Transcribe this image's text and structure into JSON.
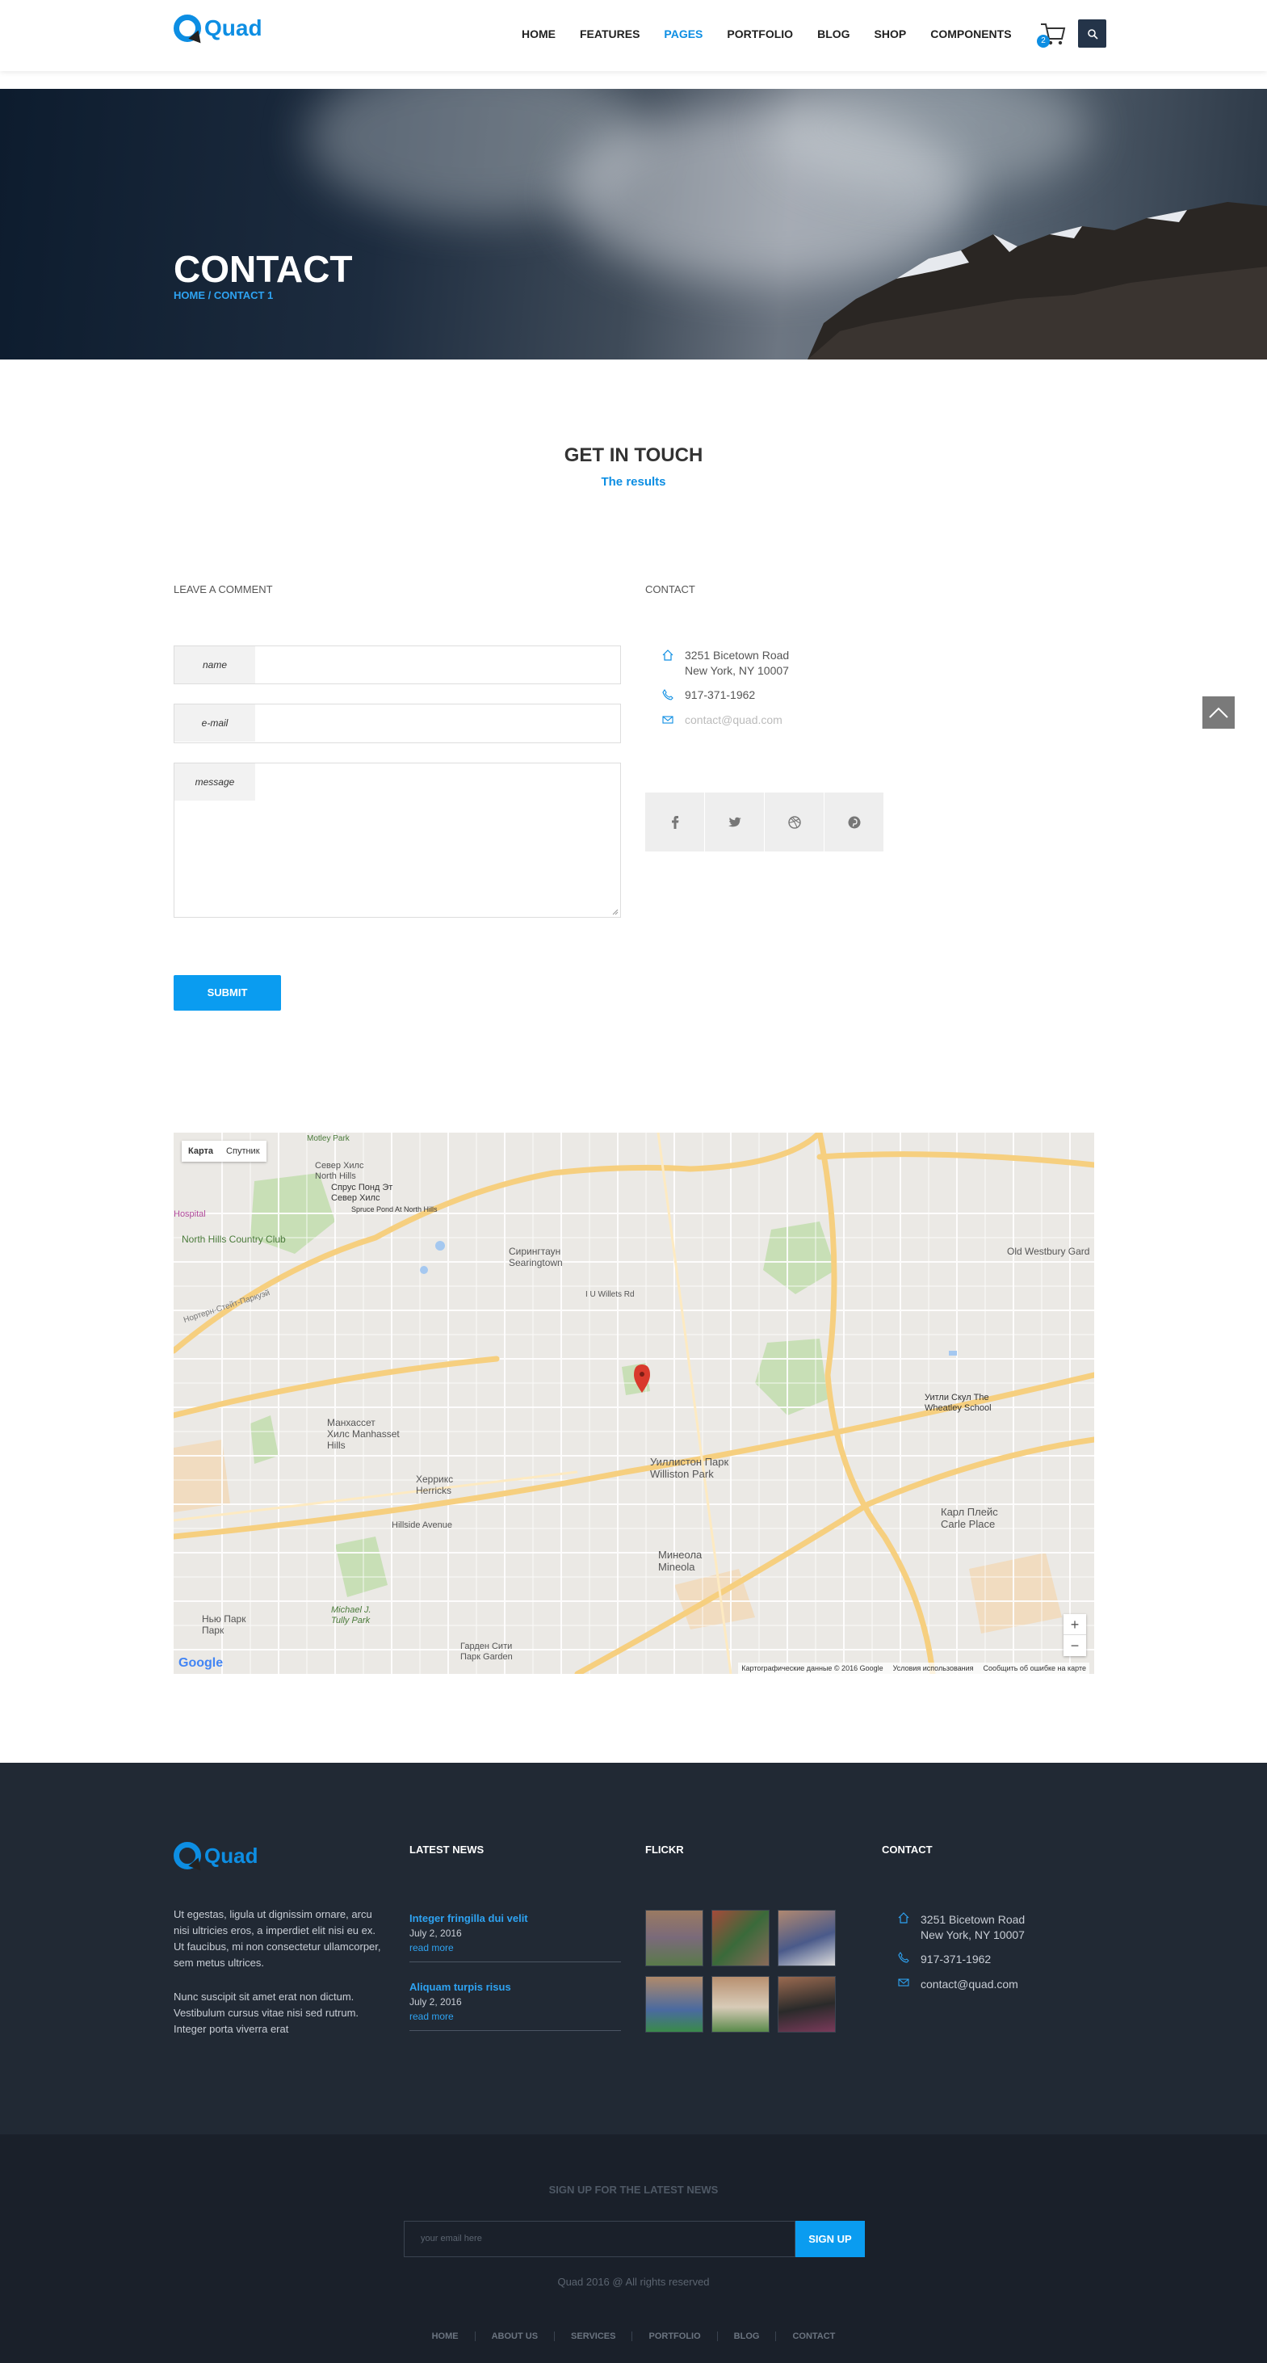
{
  "header": {
    "logo": "Quad",
    "nav": [
      "HOME",
      "FEATURES",
      "PAGES",
      "PORTFOLIO",
      "BLOG",
      "SHOP",
      "COMPONENTS"
    ],
    "active_nav": "PAGES",
    "cart_count": "2"
  },
  "hero": {
    "title": "CONTACT",
    "breadcrumb": "HOME / CONTACT 1"
  },
  "intro": {
    "title": "GET IN TOUCH",
    "subtitle": "The results"
  },
  "form": {
    "heading": "LEAVE A COMMENT",
    "name_label": "name",
    "email_label": "e-mail",
    "message_label": "message",
    "submit": "SUBMIT"
  },
  "contact": {
    "heading": "CONTACT",
    "address_line1": "3251 Bicetown Road",
    "address_line2": "New York, NY 10007",
    "phone": "917-371-1962",
    "email": "contact@quad.com"
  },
  "map": {
    "type_map": "Карта",
    "type_satellite": "Спутник",
    "zoom_in": "+",
    "zoom_out": "−",
    "attribution": [
      "Картографические данные © 2016 Google",
      "Условия использования",
      "Сообщить об ошибке на карте"
    ],
    "google": "Google",
    "labels": {
      "north_hills": "Север Хилс",
      "north_hills_en": "North Hills",
      "spruce_pond": "Спрус Понд Эт Север Хилс",
      "spruce_pond_en": "Spruce Pond At North Hills",
      "country_club": "North Hills Country Club",
      "searingtown": "Сирингтаун Searingtown",
      "old_westbury": "Old Westbury Gard",
      "manhasset": "Манхассет Хилс Manhasset Hills",
      "herricks": "Херрикс Herricks",
      "williston": "Уиллистон Парк Williston Park",
      "mineola": "Минеола Mineola",
      "carle_place": "Карл Плейс Carle Place",
      "wheatley": "Уитли Скул The Wheatley School",
      "hillside": "Hillside Avenue",
      "northern_parkway": "Нортерн-Стейт-Паркуэй",
      "michael_park": "Michael J. Tully Park",
      "garden_city": "Гарден Сити Парк Garden",
      "new_hyde": "Нью Парк Парк",
      "motley": "Motley Park",
      "hospital": "Hospital",
      "willets": "I U Willets Rd"
    }
  },
  "footer": {
    "logo": "Quad",
    "about_p1": "Ut egestas, ligula ut dignissim ornare, arcu nisi ultricies eros, a imperdiet elit nisi eu ex. Ut faucibus, mi non consectetur ullamcorper, sem metus ultrices.",
    "about_p2": "Nunc suscipit sit amet erat non dictum. Vestibulum cursus vitae nisi sed rutrum. Integer porta viverra erat",
    "news_heading": "LATEST NEWS",
    "news": [
      {
        "title": "Integer fringilla dui velit",
        "date": "July 2, 2016",
        "more": "read more"
      },
      {
        "title": "Aliquam turpis risus",
        "date": "July 2, 2016",
        "more": "read more"
      }
    ],
    "flickr_heading": "FLICKR",
    "contact_heading": "CONTACT",
    "address_line1": "3251 Bicetown Road",
    "address_line2": "New York, NY 10007",
    "phone": "917-371-1962",
    "email": "contact@quad.com"
  },
  "signup": {
    "title": "SIGN UP FOR THE LATEST NEWS",
    "placeholder": "your email here",
    "button": "SIGN UP",
    "copyright": "Quad 2016 @ All rights reserved",
    "nav": [
      "HOME",
      "ABOUT US",
      "SERVICES",
      "PORTFOLIO",
      "BLOG",
      "CONTACT"
    ]
  }
}
